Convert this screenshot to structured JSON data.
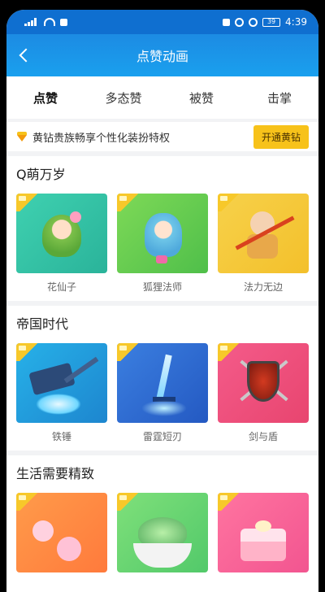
{
  "status": {
    "battery": "39",
    "time": "4:39"
  },
  "header": {
    "title": "点赞动画"
  },
  "tabs": [
    {
      "label": "点赞",
      "active": true
    },
    {
      "label": "多态赞",
      "active": false
    },
    {
      "label": "被赞",
      "active": false
    },
    {
      "label": "击掌",
      "active": false
    }
  ],
  "banner": {
    "text": "黄钻贵族畅享个性化装扮特权",
    "button": "开通黄钻"
  },
  "sections": [
    {
      "title": "Q萌万岁",
      "items": [
        {
          "name": "花仙子"
        },
        {
          "name": "狐狸法师"
        },
        {
          "name": "法力无边"
        }
      ]
    },
    {
      "title": "帝国时代",
      "items": [
        {
          "name": "铁锤"
        },
        {
          "name": "雷霆短刃"
        },
        {
          "name": "剑与盾"
        }
      ]
    },
    {
      "title": "生活需要精致",
      "items": [
        {
          "name": ""
        },
        {
          "name": ""
        },
        {
          "name": ""
        }
      ]
    }
  ],
  "colors": {
    "accent": "#1a8fe6",
    "vip": "#f7c21a"
  }
}
